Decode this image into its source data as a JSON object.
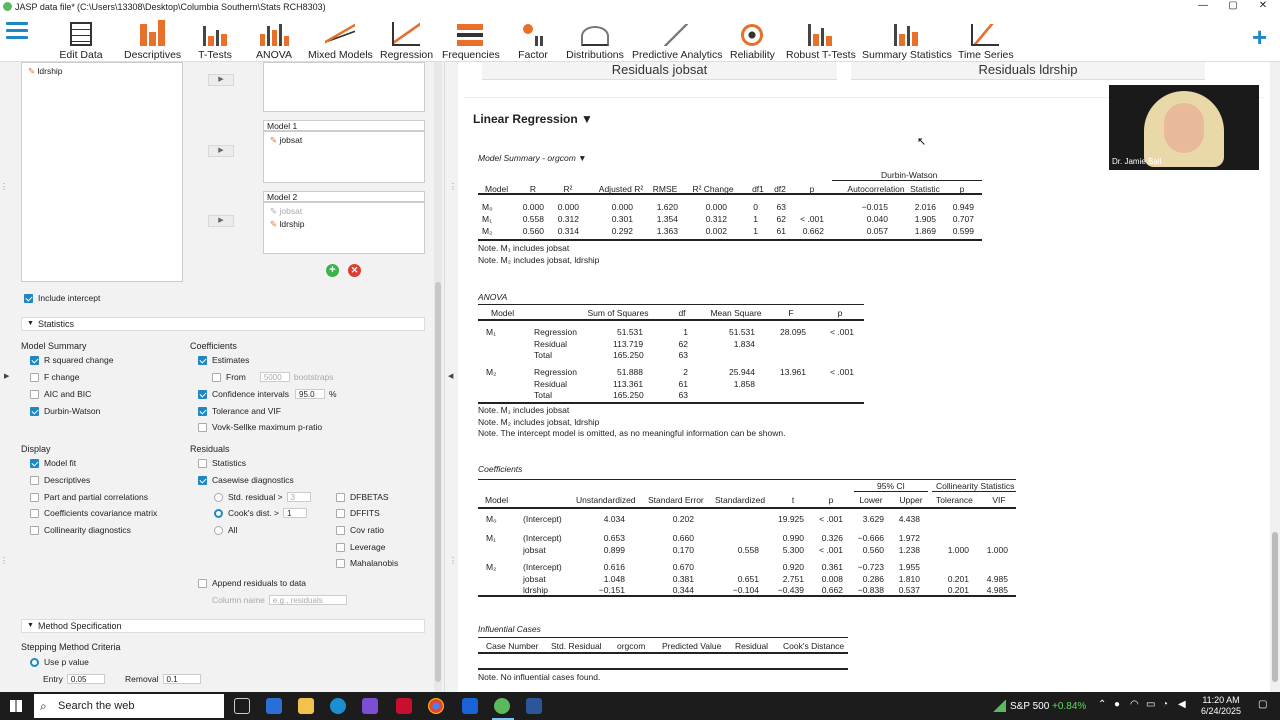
{
  "window": {
    "title": "JASP data file*",
    "path": "(C:\\Users\\13308\\Desktop\\Columbia Southern\\Stats RCH8303)",
    "min": "—",
    "max": "▢",
    "close": "✕"
  },
  "ribbon": [
    {
      "label": "Edit Data"
    },
    {
      "label": "Descriptives"
    },
    {
      "label": "T-Tests"
    },
    {
      "label": "ANOVA"
    },
    {
      "label": "Mixed Models"
    },
    {
      "label": "Regression"
    },
    {
      "label": "Frequencies"
    },
    {
      "label": "Factor"
    },
    {
      "label": "Distributions"
    },
    {
      "label": "Predictive Analytics"
    },
    {
      "label": "Reliability"
    },
    {
      "label": "Robust T-Tests"
    },
    {
      "label": "Summary Statistics"
    },
    {
      "label": "Time Series"
    }
  ],
  "left": {
    "var_top": "ldrship",
    "model1_label": "Model 1",
    "model1_var": "jobsat",
    "model2_label": "Model 2",
    "model2_var1": "jobsat",
    "model2_var2": "ldrship",
    "include_intercept": "Include intercept",
    "statistics_section": "Statistics",
    "model_summary": "Model Summary",
    "r_sq_change": "R squared change",
    "f_change": "F change",
    "aic_bic": "AIC and BIC",
    "durbin": "Durbin-Watson",
    "coefficients": "Coefficients",
    "estimates": "Estimates",
    "from": "From",
    "bootstraps_val": "5000",
    "bootstraps": "bootstraps",
    "conf_int": "Confidence intervals",
    "conf_val": "95.0",
    "pct": "%",
    "tol_vif": "Tolerance and VIF",
    "vovk": "Vovk-Sellke maximum p-ratio",
    "display": "Display",
    "model_fit": "Model fit",
    "descriptives": "Descriptives",
    "part_corr": "Part and partial correlations",
    "coef_cov": "Coefficients covariance matrix",
    "collin": "Collinearity diagnostics",
    "residuals": "Residuals",
    "res_stats": "Statistics",
    "casewise": "Casewise diagnostics",
    "std_res": "Std. residual >",
    "std_res_val": "3",
    "cooks": "Cook's dist. >",
    "cooks_val": "1",
    "all": "All",
    "dfbetas": "DFBETAS",
    "dffits": "DFFITS",
    "cov_ratio": "Cov ratio",
    "leverage": "Leverage",
    "mahal": "Mahalanobis",
    "append": "Append residuals to data",
    "col_name": "Column name",
    "col_placeholder": "e.g., residuals",
    "method_section": "Method Specification",
    "stepping": "Stepping Method Criteria",
    "use_p": "Use p value",
    "entry": "Entry",
    "entry_val": "0.05",
    "removal": "Removal",
    "removal_val": "0.1"
  },
  "right": {
    "res_jobsat": "Residuals jobsat",
    "res_ldrship": "Residuals ldrship",
    "lr_title": "Linear Regression ▼",
    "video_name": "Dr. Jamie Ball",
    "ms_title": "Model Summary - orgcom ▼",
    "ms_dw": "Durbin-Watson",
    "ms_headers": [
      "Model",
      "R",
      "R²",
      "Adjusted R²",
      "RMSE",
      "R² Change",
      "df1",
      "df2",
      "p",
      "Autocorrelation",
      "Statistic",
      "p"
    ],
    "ms_rows": [
      [
        "M₀",
        "0.000",
        "0.000",
        "0.000",
        "1.620",
        "0.000",
        "0",
        "63",
        "",
        "−0.015",
        "2.016",
        "0.949"
      ],
      [
        "M₁",
        "0.558",
        "0.312",
        "0.301",
        "1.354",
        "0.312",
        "1",
        "62",
        "< .001",
        "0.040",
        "1.905",
        "0.707"
      ],
      [
        "M₂",
        "0.560",
        "0.314",
        "0.292",
        "1.363",
        "0.002",
        "1",
        "61",
        "0.662",
        "0.057",
        "1.869",
        "0.599"
      ]
    ],
    "ms_note1": "Note. M₁ includes jobsat",
    "ms_note2": "Note. M₂ includes jobsat, ldrship",
    "anova_title": "ANOVA",
    "anova_headers": [
      "Model",
      "",
      "Sum of Squares",
      "df",
      "Mean Square",
      "F",
      "p"
    ],
    "anova_rows": [
      [
        "M₁",
        "Regression",
        "51.531",
        "1",
        "51.531",
        "28.095",
        "< .001"
      ],
      [
        "",
        "Residual",
        "113.719",
        "62",
        "1.834",
        "",
        ""
      ],
      [
        "",
        "Total",
        "165.250",
        "63",
        "",
        "",
        ""
      ],
      [
        "M₂",
        "Regression",
        "51.888",
        "2",
        "25.944",
        "13.961",
        "< .001"
      ],
      [
        "",
        "Residual",
        "113.361",
        "61",
        "1.858",
        "",
        ""
      ],
      [
        "",
        "Total",
        "165.250",
        "63",
        "",
        "",
        ""
      ]
    ],
    "anova_note1": "Note. M₁ includes jobsat",
    "anova_note2": "Note. M₂ includes jobsat, ldrship",
    "anova_note3": "Note. The intercept model is omitted, as no meaningful information can be shown.",
    "coef_title": "Coefficients",
    "coef_ci": "95% CI",
    "coef_collin": "Collinearity Statistics",
    "coef_headers": [
      "Model",
      "",
      "Unstandardized",
      "Standard Error",
      "Standardized",
      "t",
      "p",
      "Lower",
      "Upper",
      "Tolerance",
      "VIF"
    ],
    "coef_rows": [
      [
        "M₀",
        "(Intercept)",
        "4.034",
        "0.202",
        "",
        "19.925",
        "< .001",
        "3.629",
        "4.438",
        "",
        ""
      ],
      [
        "M₁",
        "(Intercept)",
        "0.653",
        "0.660",
        "",
        "0.990",
        "0.326",
        "−0.666",
        "1.972",
        "",
        ""
      ],
      [
        "",
        "jobsat",
        "0.899",
        "0.170",
        "0.558",
        "5.300",
        "< .001",
        "0.560",
        "1.238",
        "1.000",
        "1.000"
      ],
      [
        "M₂",
        "(Intercept)",
        "0.616",
        "0.670",
        "",
        "0.920",
        "0.361",
        "−0.723",
        "1.955",
        "",
        ""
      ],
      [
        "",
        "jobsat",
        "1.048",
        "0.381",
        "0.651",
        "2.751",
        "0.008",
        "0.286",
        "1.810",
        "0.201",
        "4.985"
      ],
      [
        "",
        "ldrship",
        "−0.151",
        "0.344",
        "−0.104",
        "−0.439",
        "0.662",
        "−0.838",
        "0.537",
        "0.201",
        "4.985"
      ]
    ],
    "inf_title": "Influential Cases",
    "inf_headers": [
      "Case Number",
      "Std. Residual",
      "orgcom",
      "Predicted Value",
      "Residual",
      "Cook's Distance"
    ],
    "inf_note": "Note. No influential cases found."
  },
  "taskbar": {
    "search": "Search the web",
    "stock": "S&P 500",
    "stock_change": "+0.84%",
    "time": "11:20 AM",
    "date": "6/24/2025"
  }
}
